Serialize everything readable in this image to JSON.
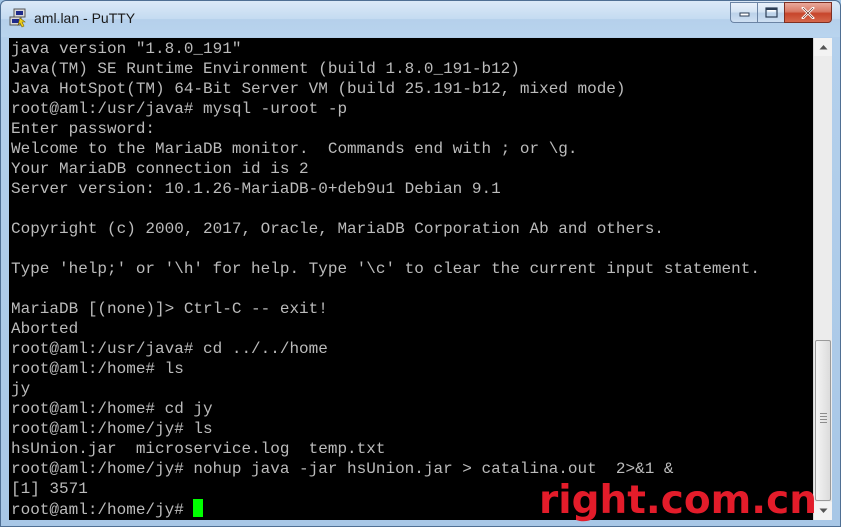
{
  "window": {
    "title": "aml.lan - PuTTY",
    "icon": "putty-app-icon"
  },
  "caption_buttons": {
    "minimize_icon": "minimize-icon",
    "maximize_icon": "maximize-icon",
    "close_icon": "close-icon"
  },
  "terminal": {
    "lines": [
      "java version \"1.8.0_191\"",
      "Java(TM) SE Runtime Environment (build 1.8.0_191-b12)",
      "Java HotSpot(TM) 64-Bit Server VM (build 25.191-b12, mixed mode)",
      "root@aml:/usr/java# mysql -uroot -p",
      "Enter password:",
      "Welcome to the MariaDB monitor.  Commands end with ; or \\g.",
      "Your MariaDB connection id is 2",
      "Server version: 10.1.26-MariaDB-0+deb9u1 Debian 9.1",
      "",
      "Copyright (c) 2000, 2017, Oracle, MariaDB Corporation Ab and others.",
      "",
      "Type 'help;' or '\\h' for help. Type '\\c' to clear the current input statement.",
      "",
      "MariaDB [(none)]> Ctrl-C -- exit!",
      "Aborted",
      "root@aml:/usr/java# cd ../../home",
      "root@aml:/home# ls",
      "jy",
      "root@aml:/home# cd jy",
      "root@aml:/home/jy# ls",
      "hsUnion.jar  microservice.log  temp.txt",
      "root@aml:/home/jy# nohup java -jar hsUnion.jar > catalina.out  2>&1 &",
      "[1] 3571"
    ],
    "prompt": "root@aml:/home/jy# ",
    "text_color": "#bbbbbb",
    "background_color": "#000000",
    "cursor_color": "#00ff00"
  },
  "scrollbar": {
    "up_icon": "scroll-up-arrow-icon",
    "down_icon": "scroll-down-arrow-icon"
  },
  "watermark": {
    "text": "right.com.cn",
    "color": "#e31c2a"
  }
}
